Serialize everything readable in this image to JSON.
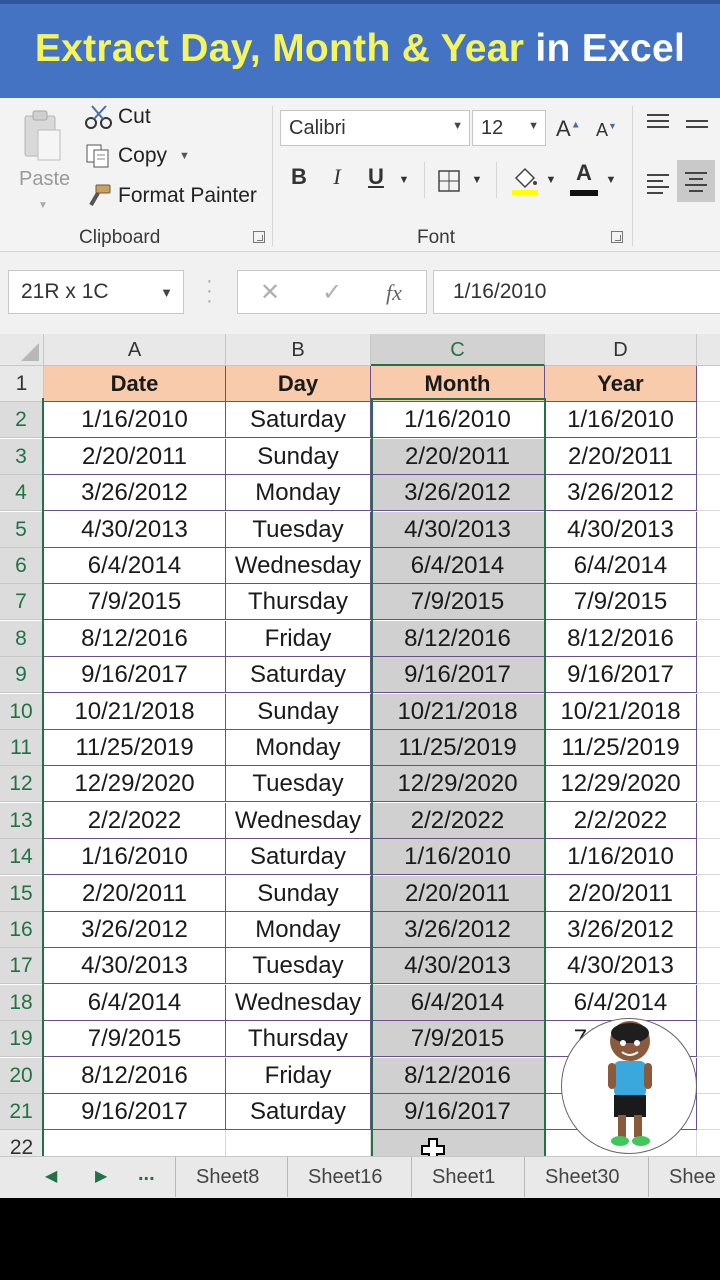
{
  "banner": {
    "title_highlight": "Extract Day, Month & Year",
    "title_rest": " in Excel",
    "colors": {
      "background": "#4573c4",
      "highlight": "#f4f45c",
      "rest": "#ffffff"
    }
  },
  "ribbon": {
    "clipboard": {
      "paste_label": "Paste",
      "cut_label": "Cut",
      "copy_label": "Copy",
      "format_painter_label": "Format Painter",
      "group_label": "Clipboard"
    },
    "font": {
      "font_name": "Calibri",
      "font_size": "12",
      "bold_label": "B",
      "italic_label": "I",
      "underline_label": "U",
      "grow_label": "A",
      "shrink_label": "A",
      "font_color_label": "A",
      "group_label": "Font"
    }
  },
  "formula_bar": {
    "name_box": "21R x 1C",
    "cancel_glyph": "✕",
    "enter_glyph": "✓",
    "fx_label": "fx",
    "formula": "1/16/2010"
  },
  "sheet": {
    "columns": [
      "A",
      "B",
      "C",
      "D"
    ],
    "rows": [
      "1",
      "2",
      "3",
      "4",
      "5",
      "6",
      "7",
      "8",
      "9",
      "10",
      "11",
      "12",
      "13",
      "14",
      "15",
      "16",
      "17",
      "18",
      "19",
      "20",
      "21",
      "22"
    ],
    "headers": [
      "Date",
      "Day",
      "Month",
      "Year"
    ],
    "data": [
      [
        "1/16/2010",
        "Saturday",
        "1/16/2010",
        "1/16/2010"
      ],
      [
        "2/20/2011",
        "Sunday",
        "2/20/2011",
        "2/20/2011"
      ],
      [
        "3/26/2012",
        "Monday",
        "3/26/2012",
        "3/26/2012"
      ],
      [
        "4/30/2013",
        "Tuesday",
        "4/30/2013",
        "4/30/2013"
      ],
      [
        "6/4/2014",
        "Wednesday",
        "6/4/2014",
        "6/4/2014"
      ],
      [
        "7/9/2015",
        "Thursday",
        "7/9/2015",
        "7/9/2015"
      ],
      [
        "8/12/2016",
        "Friday",
        "8/12/2016",
        "8/12/2016"
      ],
      [
        "9/16/2017",
        "Saturday",
        "9/16/2017",
        "9/16/2017"
      ],
      [
        "10/21/2018",
        "Sunday",
        "10/21/2018",
        "10/21/2018"
      ],
      [
        "11/25/2019",
        "Monday",
        "11/25/2019",
        "11/25/2019"
      ],
      [
        "12/29/2020",
        "Tuesday",
        "12/29/2020",
        "12/29/2020"
      ],
      [
        "2/2/2022",
        "Wednesday",
        "2/2/2022",
        "2/2/2022"
      ],
      [
        "1/16/2010",
        "Saturday",
        "1/16/2010",
        "1/16/2010"
      ],
      [
        "2/20/2011",
        "Sunday",
        "2/20/2011",
        "2/20/2011"
      ],
      [
        "3/26/2012",
        "Monday",
        "3/26/2012",
        "3/26/2012"
      ],
      [
        "4/30/2013",
        "Tuesday",
        "4/30/2013",
        "4/30/2013"
      ],
      [
        "6/4/2014",
        "Wednesday",
        "6/4/2014",
        "6/4/2014"
      ],
      [
        "7/9/2015",
        "Thursday",
        "7/9/2015",
        "7/9/2015"
      ],
      [
        "8/12/2016",
        "Friday",
        "8/12/2016",
        "8/12/2016"
      ],
      [
        "9/16/2017",
        "Saturday",
        "9/16/2017",
        "9/16/2017"
      ]
    ],
    "header_fill": "#f8cbad",
    "selected_column": "C",
    "selection_color": "#217346"
  },
  "sheet_tabs": {
    "more_label": "...",
    "tabs": [
      "Sheet8",
      "Sheet16",
      "Sheet1",
      "Sheet30",
      "Shee"
    ]
  },
  "icons": [
    "paste-icon",
    "cut-icon",
    "copy-icon",
    "format-painter-icon",
    "borders-icon",
    "fill-color-icon",
    "align-left-icon",
    "align-center-icon",
    "cell-cursor-icon",
    "avatar-icon"
  ]
}
